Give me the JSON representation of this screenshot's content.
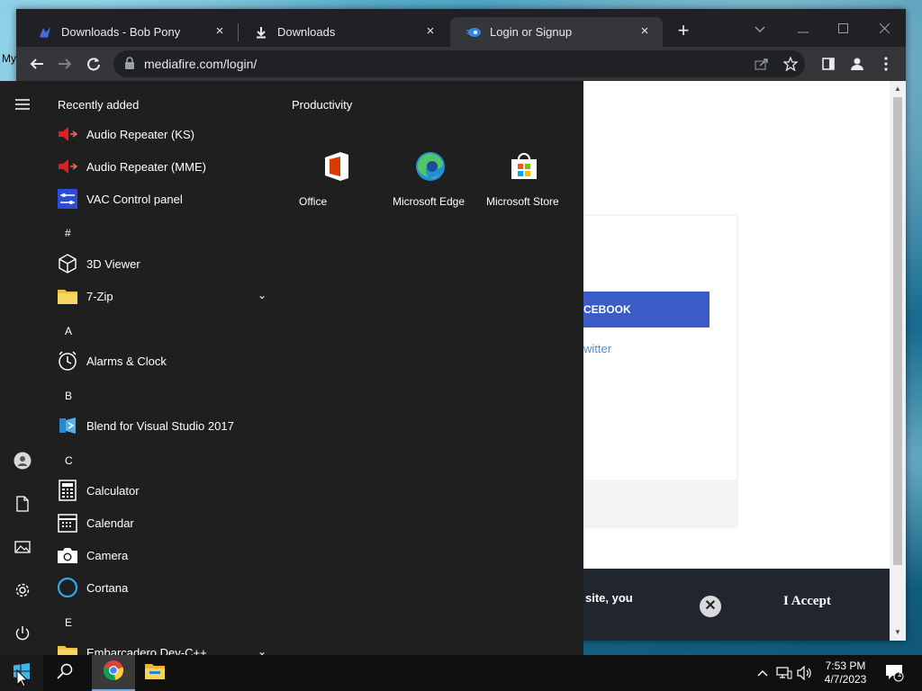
{
  "desktop": {
    "label": "My"
  },
  "browser": {
    "tabs": [
      {
        "title": "Downloads - Bob Pony",
        "icon": "bob-pony-favicon",
        "close": "×"
      },
      {
        "title": "Downloads",
        "icon": "download-icon",
        "close": "×"
      },
      {
        "title": "Login or Signup",
        "icon": "mediafire-favicon",
        "close": "×"
      }
    ],
    "new_tab": "+",
    "url": "mediafire.com/login/"
  },
  "webpage": {
    "facebook_button": "ITH FACEBOOK",
    "twitter_link": "witter",
    "cookie_text": "site, you",
    "cookie_close": "✕",
    "accept_button": "I Accept"
  },
  "start_menu": {
    "recently_added_header": "Recently added",
    "recent_apps": [
      {
        "label": "Audio Repeater (KS)",
        "icon": "audio-repeater-icon"
      },
      {
        "label": "Audio Repeater (MME)",
        "icon": "audio-repeater-icon"
      },
      {
        "label": "VAC Control panel",
        "icon": "vac-control-icon"
      }
    ],
    "sections": [
      {
        "letter": "#",
        "apps": [
          {
            "label": "3D Viewer",
            "icon": "cube-icon"
          },
          {
            "label": "7-Zip",
            "icon": "folder-icon",
            "expandable": true
          }
        ]
      },
      {
        "letter": "A",
        "apps": [
          {
            "label": "Alarms & Clock",
            "icon": "clock-icon"
          }
        ]
      },
      {
        "letter": "B",
        "apps": [
          {
            "label": "Blend for Visual Studio 2017",
            "icon": "blend-icon"
          }
        ]
      },
      {
        "letter": "C",
        "apps": [
          {
            "label": "Calculator",
            "icon": "calculator-icon"
          },
          {
            "label": "Calendar",
            "icon": "calendar-icon"
          },
          {
            "label": "Camera",
            "icon": "camera-icon"
          },
          {
            "label": "Cortana",
            "icon": "cortana-icon"
          }
        ]
      },
      {
        "letter": "E",
        "apps": [
          {
            "label": "Embarcadero Dev-C++",
            "icon": "folder-icon",
            "expandable": true
          }
        ]
      }
    ],
    "expand_glyph": "⌄",
    "group_title": "Productivity",
    "tiles": [
      {
        "label": "Office",
        "color": "#d83b01",
        "icon": "office-icon"
      },
      {
        "label": "Microsoft Edge",
        "color": "#3a3a3a",
        "icon": "edge-icon"
      },
      {
        "label": "Microsoft Store",
        "color": "#3a3a3a",
        "icon": "store-icon"
      }
    ]
  },
  "taskbar": {
    "time": "7:53 PM",
    "date": "4/7/2023",
    "notification_count": "1"
  }
}
